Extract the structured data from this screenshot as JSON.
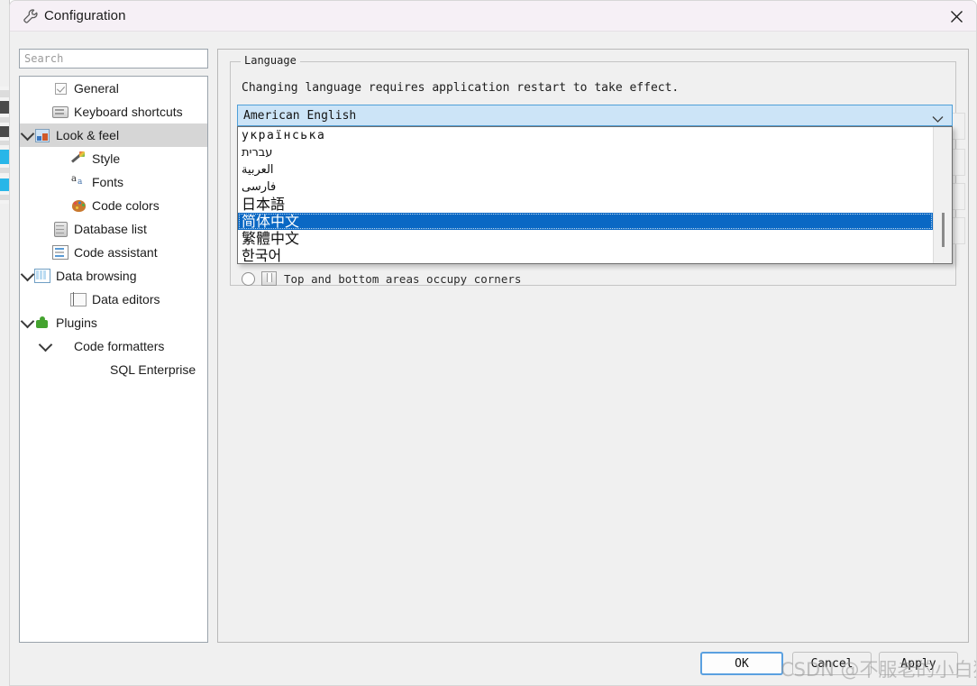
{
  "window": {
    "title": "Configuration",
    "title_icon": "wrench-icon",
    "close_icon": "close-icon"
  },
  "sidebar": {
    "search_placeholder": "Search",
    "items": [
      {
        "label": "General",
        "icon": "checkbox-icon",
        "indent": 1,
        "arrow": "",
        "selected": false
      },
      {
        "label": "Keyboard shortcuts",
        "icon": "keyboard-icon",
        "indent": 1,
        "arrow": "",
        "selected": false
      },
      {
        "label": "Look & feel",
        "icon": "look-and-feel-icon",
        "indent": 0,
        "arrow": "down",
        "selected": true
      },
      {
        "label": "Style",
        "icon": "magic-wand-icon",
        "indent": 2,
        "arrow": "",
        "selected": false
      },
      {
        "label": "Fonts",
        "icon": "fonts-icon",
        "indent": 2,
        "arrow": "",
        "selected": false
      },
      {
        "label": "Code colors",
        "icon": "palette-icon",
        "indent": 2,
        "arrow": "",
        "selected": false
      },
      {
        "label": "Database list",
        "icon": "database-list-icon",
        "indent": 1,
        "arrow": "",
        "selected": false
      },
      {
        "label": "Code assistant",
        "icon": "code-assistant-icon",
        "indent": 1,
        "arrow": "",
        "selected": false
      },
      {
        "label": "Data browsing",
        "icon": "data-browsing-icon",
        "indent": 0,
        "arrow": "down",
        "selected": false
      },
      {
        "label": "Data editors",
        "icon": "data-editors-icon",
        "indent": 2,
        "arrow": "",
        "selected": false
      },
      {
        "label": "Plugins",
        "icon": "plugin-icon",
        "indent": 0,
        "arrow": "down",
        "selected": false
      },
      {
        "label": "Code formatters",
        "icon": "",
        "indent": 1,
        "arrow": "down",
        "selected": false
      },
      {
        "label": "SQL Enterprise",
        "icon": "",
        "indent": 3,
        "arrow": "",
        "selected": false
      }
    ]
  },
  "main": {
    "group_title": "Language",
    "description": "Changing language requires application restart to take effect.",
    "combo": {
      "selected_value": "American English",
      "arrow_icon": "chevron-down-icon",
      "options": [
        {
          "label": "українська",
          "style": "mono",
          "selected": false
        },
        {
          "label": "עברית",
          "style": "rtl",
          "selected": false
        },
        {
          "label": "العربية",
          "style": "rtl",
          "selected": false
        },
        {
          "label": "فارسی",
          "style": "rtl",
          "selected": false
        },
        {
          "label": "日本語",
          "style": "cjk",
          "selected": false
        },
        {
          "label": "简体中文",
          "style": "cjk",
          "selected": true
        },
        {
          "label": "繁體中文",
          "style": "cjk",
          "selected": false
        },
        {
          "label": "한국어",
          "style": "cjk",
          "selected": false
        }
      ]
    },
    "radio_option": {
      "label": "Top and bottom areas occupy corners",
      "checked": false
    }
  },
  "footer": {
    "ok_label": "OK",
    "cancel_label": "Cancel",
    "apply_label": "Apply"
  },
  "watermark": {
    "text": "CSDN @不服老的小白猿"
  },
  "colors": {
    "accent_selection": "#0a68c4",
    "combo_head_bg": "#cce4f7",
    "combo_head_border": "#4f9fd8",
    "tree_selected_bg": "#d6d6d6",
    "titlebar_bg": "#f6f0f6",
    "panel_bg": "#f0f0f0",
    "ok_button_border": "#5aa0e0"
  }
}
